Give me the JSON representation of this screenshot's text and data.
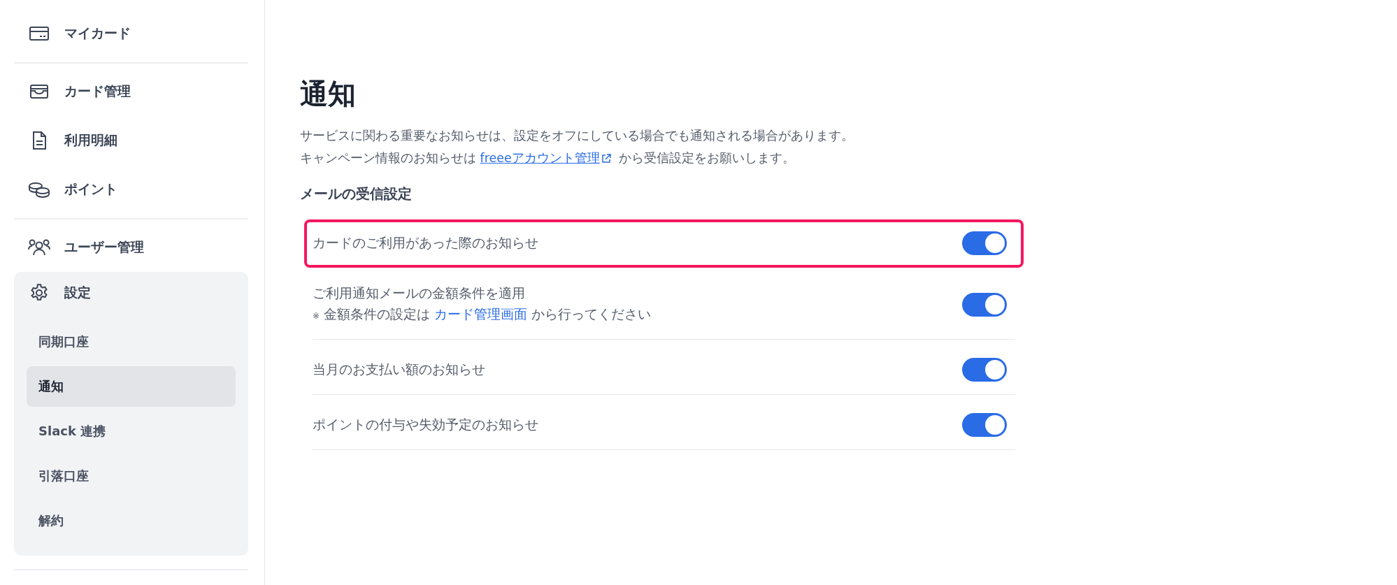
{
  "sidebar": {
    "groups": [
      {
        "items": [
          {
            "label": "マイカード"
          }
        ]
      },
      {
        "items": [
          {
            "label": "カード管理"
          },
          {
            "label": "利用明細"
          },
          {
            "label": "ポイント"
          }
        ]
      },
      {
        "items": [
          {
            "label": "ユーザー管理"
          },
          {
            "label": "設定",
            "expanded": true,
            "children": [
              {
                "label": "同期口座",
                "selected": false
              },
              {
                "label": "通知",
                "selected": true
              },
              {
                "label": "Slack 連携",
                "selected": false
              },
              {
                "label": "引落口座",
                "selected": false
              },
              {
                "label": "解約",
                "selected": false
              }
            ]
          }
        ]
      }
    ]
  },
  "main": {
    "title": "通知",
    "notice": {
      "line_1": "サービスに関わる重要なお知らせは、設定をオフにしている場合でも通知される場合があります。",
      "line_2_before": "キャンペーン情報のお知らせは",
      "line_2_link": "freeeアカウント管理",
      "line_2_after": "から受信設定をお願いします。"
    },
    "section_title": "メールの受信設定",
    "settings": [
      {
        "label": "カードのご利用があった際のお知らせ",
        "on": true,
        "highlighted": true
      },
      {
        "label": "ご利用通知メールの金額条件を適用",
        "note": {
          "mark": "※",
          "before": "金額条件の設定は",
          "link": "カード管理画面",
          "after": "から行ってください"
        },
        "on": true,
        "highlighted": false
      },
      {
        "label": "当月のお支払い額のお知らせ",
        "on": true,
        "highlighted": false
      },
      {
        "label": "ポイントの付与や失効予定のお知らせ",
        "on": true,
        "highlighted": false
      }
    ]
  }
}
